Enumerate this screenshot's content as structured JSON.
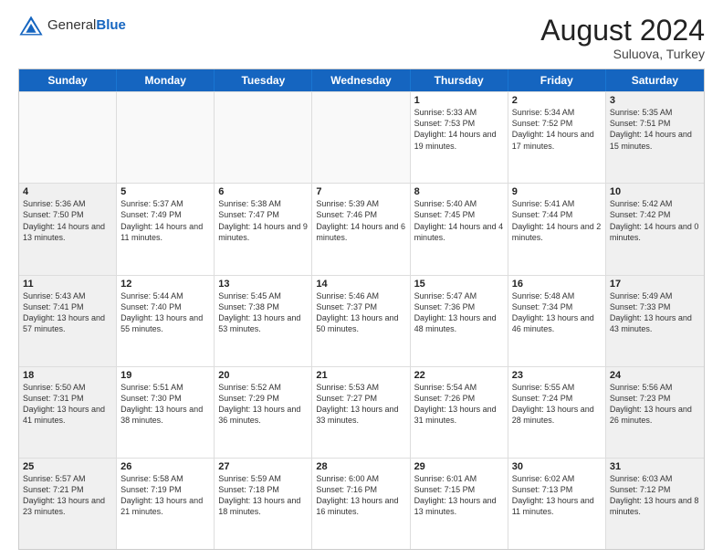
{
  "logo": {
    "general": "General",
    "blue": "Blue"
  },
  "title": "August 2024",
  "location": "Suluova, Turkey",
  "header_days": [
    "Sunday",
    "Monday",
    "Tuesday",
    "Wednesday",
    "Thursday",
    "Friday",
    "Saturday"
  ],
  "weeks": [
    [
      {
        "day": "",
        "empty": true
      },
      {
        "day": "",
        "empty": true
      },
      {
        "day": "",
        "empty": true
      },
      {
        "day": "",
        "empty": true
      },
      {
        "day": "1",
        "sunrise": "5:33 AM",
        "sunset": "7:53 PM",
        "daylight": "14 hours and 19 minutes."
      },
      {
        "day": "2",
        "sunrise": "5:34 AM",
        "sunset": "7:52 PM",
        "daylight": "14 hours and 17 minutes."
      },
      {
        "day": "3",
        "sunrise": "5:35 AM",
        "sunset": "7:51 PM",
        "daylight": "14 hours and 15 minutes."
      }
    ],
    [
      {
        "day": "4",
        "sunrise": "5:36 AM",
        "sunset": "7:50 PM",
        "daylight": "14 hours and 13 minutes."
      },
      {
        "day": "5",
        "sunrise": "5:37 AM",
        "sunset": "7:49 PM",
        "daylight": "14 hours and 11 minutes."
      },
      {
        "day": "6",
        "sunrise": "5:38 AM",
        "sunset": "7:47 PM",
        "daylight": "14 hours and 9 minutes."
      },
      {
        "day": "7",
        "sunrise": "5:39 AM",
        "sunset": "7:46 PM",
        "daylight": "14 hours and 6 minutes."
      },
      {
        "day": "8",
        "sunrise": "5:40 AM",
        "sunset": "7:45 PM",
        "daylight": "14 hours and 4 minutes."
      },
      {
        "day": "9",
        "sunrise": "5:41 AM",
        "sunset": "7:44 PM",
        "daylight": "14 hours and 2 minutes."
      },
      {
        "day": "10",
        "sunrise": "5:42 AM",
        "sunset": "7:42 PM",
        "daylight": "14 hours and 0 minutes."
      }
    ],
    [
      {
        "day": "11",
        "sunrise": "5:43 AM",
        "sunset": "7:41 PM",
        "daylight": "13 hours and 57 minutes."
      },
      {
        "day": "12",
        "sunrise": "5:44 AM",
        "sunset": "7:40 PM",
        "daylight": "13 hours and 55 minutes."
      },
      {
        "day": "13",
        "sunrise": "5:45 AM",
        "sunset": "7:38 PM",
        "daylight": "13 hours and 53 minutes."
      },
      {
        "day": "14",
        "sunrise": "5:46 AM",
        "sunset": "7:37 PM",
        "daylight": "13 hours and 50 minutes."
      },
      {
        "day": "15",
        "sunrise": "5:47 AM",
        "sunset": "7:36 PM",
        "daylight": "13 hours and 48 minutes."
      },
      {
        "day": "16",
        "sunrise": "5:48 AM",
        "sunset": "7:34 PM",
        "daylight": "13 hours and 46 minutes."
      },
      {
        "day": "17",
        "sunrise": "5:49 AM",
        "sunset": "7:33 PM",
        "daylight": "13 hours and 43 minutes."
      }
    ],
    [
      {
        "day": "18",
        "sunrise": "5:50 AM",
        "sunset": "7:31 PM",
        "daylight": "13 hours and 41 minutes."
      },
      {
        "day": "19",
        "sunrise": "5:51 AM",
        "sunset": "7:30 PM",
        "daylight": "13 hours and 38 minutes."
      },
      {
        "day": "20",
        "sunrise": "5:52 AM",
        "sunset": "7:29 PM",
        "daylight": "13 hours and 36 minutes."
      },
      {
        "day": "21",
        "sunrise": "5:53 AM",
        "sunset": "7:27 PM",
        "daylight": "13 hours and 33 minutes."
      },
      {
        "day": "22",
        "sunrise": "5:54 AM",
        "sunset": "7:26 PM",
        "daylight": "13 hours and 31 minutes."
      },
      {
        "day": "23",
        "sunrise": "5:55 AM",
        "sunset": "7:24 PM",
        "daylight": "13 hours and 28 minutes."
      },
      {
        "day": "24",
        "sunrise": "5:56 AM",
        "sunset": "7:23 PM",
        "daylight": "13 hours and 26 minutes."
      }
    ],
    [
      {
        "day": "25",
        "sunrise": "5:57 AM",
        "sunset": "7:21 PM",
        "daylight": "13 hours and 23 minutes."
      },
      {
        "day": "26",
        "sunrise": "5:58 AM",
        "sunset": "7:19 PM",
        "daylight": "13 hours and 21 minutes."
      },
      {
        "day": "27",
        "sunrise": "5:59 AM",
        "sunset": "7:18 PM",
        "daylight": "13 hours and 18 minutes."
      },
      {
        "day": "28",
        "sunrise": "6:00 AM",
        "sunset": "7:16 PM",
        "daylight": "13 hours and 16 minutes."
      },
      {
        "day": "29",
        "sunrise": "6:01 AM",
        "sunset": "7:15 PM",
        "daylight": "13 hours and 13 minutes."
      },
      {
        "day": "30",
        "sunrise": "6:02 AM",
        "sunset": "7:13 PM",
        "daylight": "13 hours and 11 minutes."
      },
      {
        "day": "31",
        "sunrise": "6:03 AM",
        "sunset": "7:12 PM",
        "daylight": "13 hours and 8 minutes."
      }
    ]
  ]
}
